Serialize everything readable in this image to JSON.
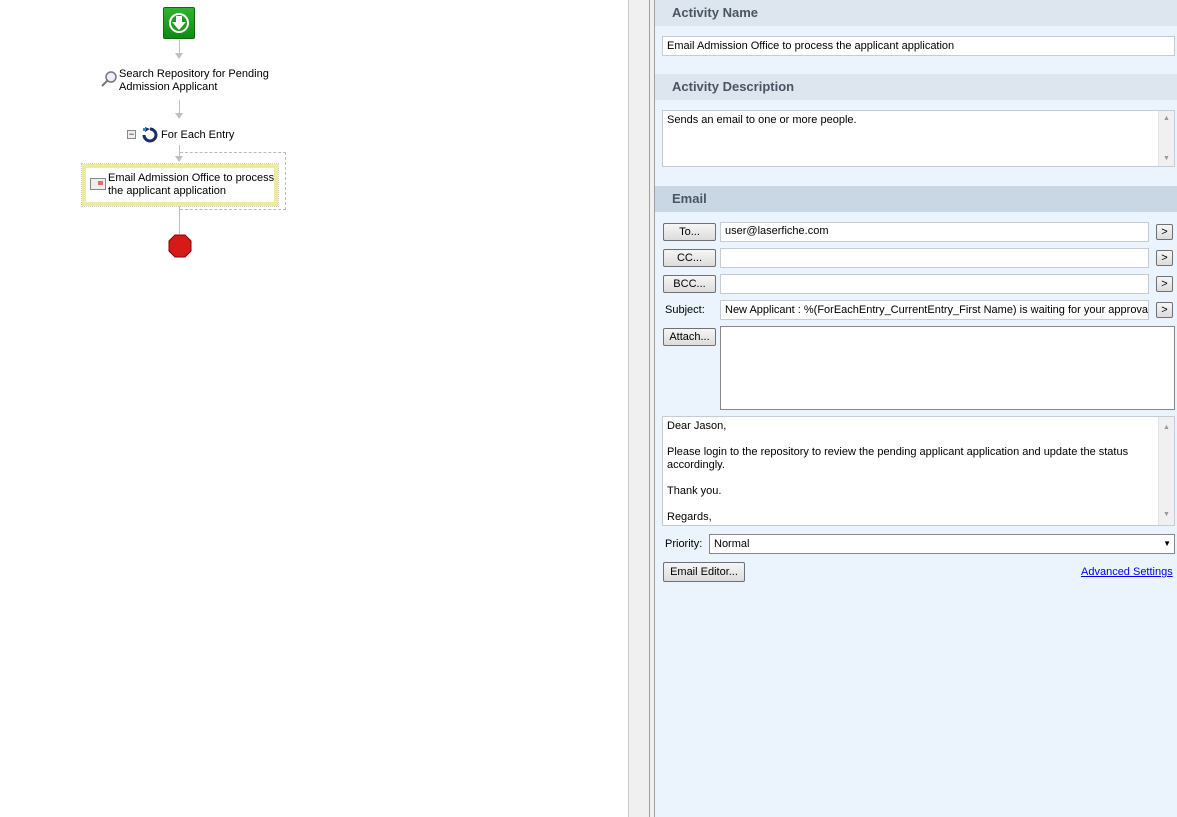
{
  "workflow": {
    "steps": [
      {
        "label": "Search Repository for Pending Admission Applicant"
      },
      {
        "label": "For Each Entry"
      },
      {
        "label": "Email Admission Office to process the applicant application"
      }
    ]
  },
  "panel": {
    "activity_name_header": "Activity Name",
    "activity_name": "Email Admission Office to process the applicant application",
    "activity_description_header": "Activity Description",
    "activity_description": "Sends an email to one or more people.",
    "email_header": "Email",
    "to_button": "To...",
    "to_value": "user@laserfiche.com",
    "cc_button": "CC...",
    "cc_value": "",
    "bcc_button": "BCC...",
    "bcc_value": "",
    "subject_label": "Subject:",
    "subject_value": "New Applicant : %(ForEachEntry_CurrentEntry_First Name)  is waiting for your approval",
    "attach_button": "Attach...",
    "expand_button": ">",
    "body_lines": [
      "Dear Jason,",
      "",
      "Please login to the repository to review the pending applicant application and update the status accordingly.",
      "",
      "Thank you.",
      "",
      "Regards,"
    ],
    "priority_label": "Priority:",
    "priority_value": "Normal",
    "email_editor_button": "Email Editor...",
    "advanced_settings_link": "Advanced Settings"
  }
}
